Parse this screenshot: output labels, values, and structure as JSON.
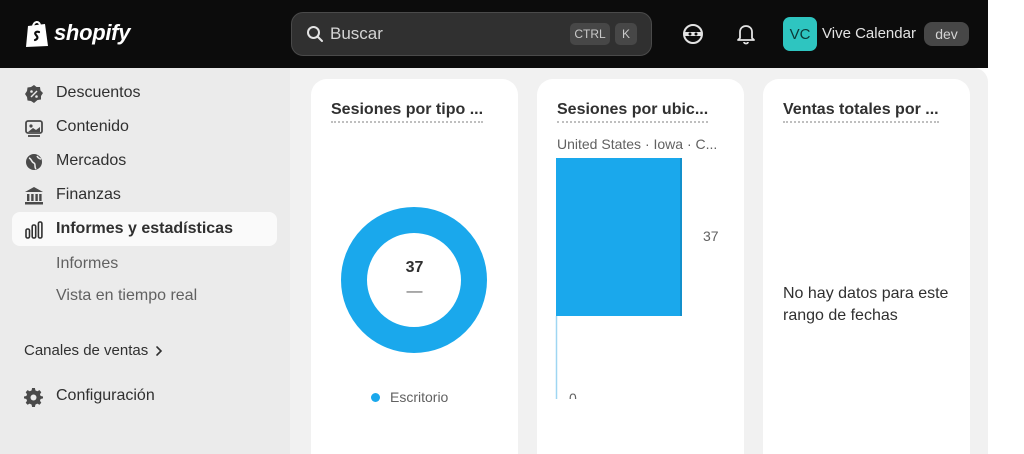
{
  "topbar": {
    "logo_text": "shopify",
    "search": {
      "placeholder": "Buscar",
      "value": "",
      "shortcut_ctrl": "CTRL",
      "shortcut_key": "K"
    },
    "store": {
      "initials": "VC",
      "name": "Vive Calendar",
      "badge": "dev"
    },
    "icons": [
      "mask-icon",
      "bell-icon"
    ]
  },
  "sidebar": {
    "items": [
      {
        "label": "Descuentos",
        "icon": "discount-icon"
      },
      {
        "label": "Contenido",
        "icon": "content-icon"
      },
      {
        "label": "Mercados",
        "icon": "globe-icon"
      },
      {
        "label": "Finanzas",
        "icon": "bank-icon"
      },
      {
        "label": "Informes y estadísticas",
        "icon": "analytics-icon",
        "active": true
      }
    ],
    "subitems": [
      "Informes",
      "Vista en tiempo real"
    ],
    "channels_label": "Canales de ventas",
    "settings_label": "Configuración"
  },
  "cards": [
    {
      "title": "Sesiones por tipo ...",
      "center_value": "37",
      "center_sub": "—",
      "legend": "Escritorio"
    },
    {
      "title": "Sesiones por ubic...",
      "subtitle": "United States · Iowa · C..."
    },
    {
      "title": "Ventas totales por ...",
      "empty_message": "No hay datos para este rango de fechas"
    }
  ],
  "colors": {
    "accent": "#1aa8ec",
    "topbar": "#0c0c0c",
    "avatar": "#2ec5c0"
  },
  "chart_data": [
    {
      "type": "pie",
      "categories": [
        "Escritorio"
      ],
      "values": [
        37
      ],
      "title": "Sesiones por tipo ..."
    },
    {
      "type": "bar",
      "categories": [
        "United States · Iowa · C..."
      ],
      "values": [
        37
      ],
      "tick_labels": [
        "37",
        "0"
      ],
      "ylim": [
        0,
        37
      ],
      "title": "Sesiones por ubic..."
    }
  ]
}
